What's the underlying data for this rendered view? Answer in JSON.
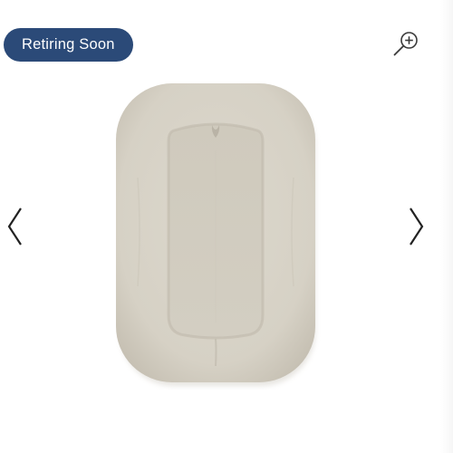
{
  "badge": {
    "label": "Retiring Soon",
    "color": "#2b4a78"
  },
  "icons": {
    "zoom": "zoom-in-icon",
    "previous": "chevron-left-icon",
    "next": "chevron-right-icon"
  },
  "product": {
    "color": "#d7d2c7"
  }
}
